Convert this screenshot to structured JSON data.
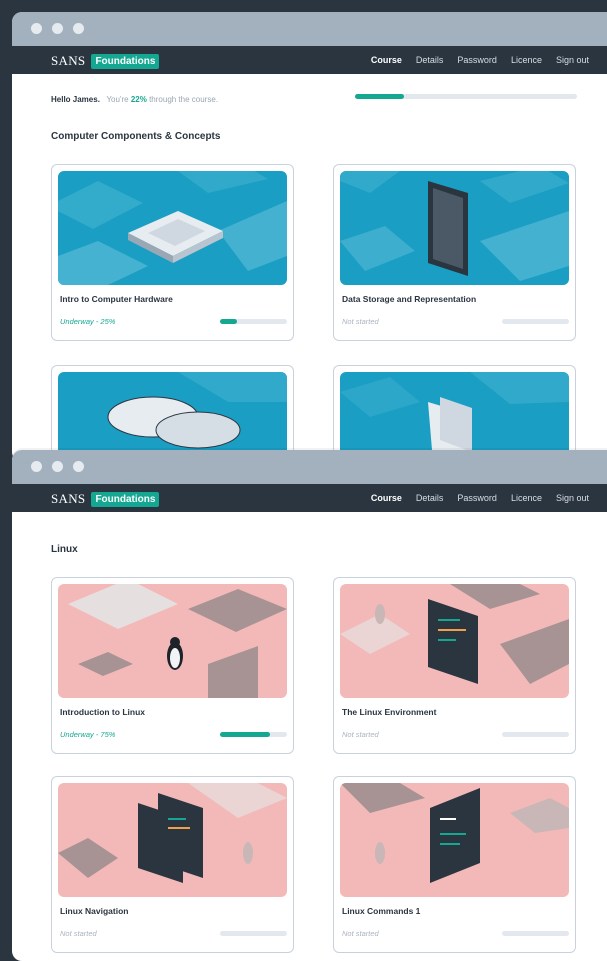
{
  "brand": {
    "name": "SANS",
    "badge": "Foundations"
  },
  "nav": {
    "items": [
      "Course",
      "Details",
      "Password",
      "Licence",
      "Sign out"
    ],
    "active": "Course"
  },
  "greeting": {
    "hello": "Hello James.",
    "prefix": "You're",
    "percent": "22%",
    "suffix": "through the course.",
    "progress": 0.22
  },
  "sections": [
    {
      "title": "Computer Components & Concepts",
      "courses": [
        {
          "title": "Intro to Computer Hardware",
          "status": "Underway - 25%",
          "progress": 0.25,
          "theme": "blue",
          "art": "cpu-chip"
        },
        {
          "title": "Data Storage and Representation",
          "status": "Not started",
          "progress": 0,
          "theme": "blue",
          "art": "data-panel"
        },
        {
          "title": "",
          "status": "",
          "progress": 0,
          "theme": "blue",
          "art": "disks"
        },
        {
          "title": "",
          "status": "",
          "progress": 0,
          "theme": "blue",
          "art": "folder"
        }
      ]
    },
    {
      "title": "Linux",
      "courses": [
        {
          "title": "Introduction to Linux",
          "status": "Underway - 75%",
          "progress": 0.75,
          "theme": "pink",
          "art": "penguin-keyboard"
        },
        {
          "title": "The Linux Environment",
          "status": "Not started",
          "progress": 0,
          "theme": "pink",
          "art": "terminal-penguin"
        },
        {
          "title": "Linux Navigation",
          "status": "Not started",
          "progress": 0,
          "theme": "pink",
          "art": "screens-penguin"
        },
        {
          "title": "Linux Commands 1",
          "status": "Not started",
          "progress": 0,
          "theme": "pink",
          "art": "terminal-command"
        }
      ]
    }
  ],
  "colors": {
    "accent": "#14a892",
    "navbar": "#2a3540",
    "chrome": "#a3b0bd",
    "blue_art": "#1a9ec3",
    "pink_art": "#f3b9b8"
  }
}
